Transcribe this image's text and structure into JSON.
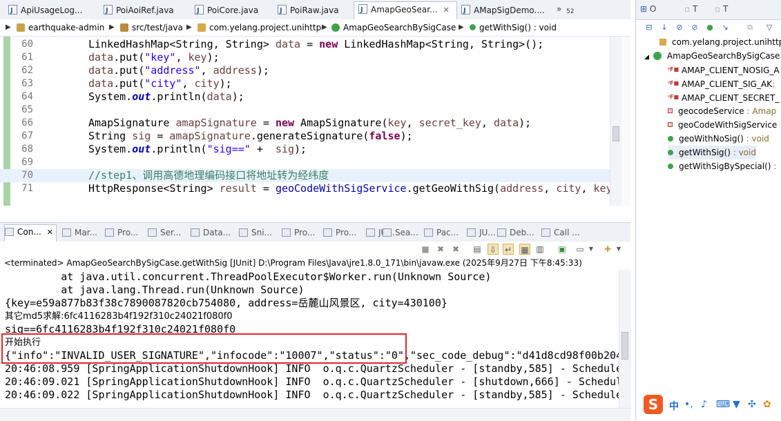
{
  "editor_tabs": [
    {
      "label": "ApiUsageLog...",
      "active": false
    },
    {
      "label": "PoiAoiRef.java",
      "active": false
    },
    {
      "label": "PoiCore.java",
      "active": false
    },
    {
      "label": "PoiRaw.java",
      "active": false
    },
    {
      "label": "AmapGeoSear...",
      "active": true,
      "close": "✕"
    },
    {
      "label": "AMapSigDemo....",
      "active": false
    }
  ],
  "tabs_overflow": {
    "chevron": "»",
    "count": "52"
  },
  "breadcrumb": [
    {
      "label": "earthquake-admin",
      "icon": "project-icon"
    },
    {
      "label": "src/test/java",
      "icon": "source-folder-icon"
    },
    {
      "label": "com.yelang.project.unihttp",
      "icon": "package-icon"
    },
    {
      "label": "AmapGeoSearchBySigCase",
      "icon": "class-icon"
    },
    {
      "label": "getWithSig() : void",
      "icon": "method-icon"
    }
  ],
  "code": {
    "line_numbers": [
      "60",
      "61",
      "62",
      "63",
      "64",
      "65",
      "66",
      "67",
      "68",
      "69",
      "70",
      "71"
    ],
    "lines": [
      [
        {
          "t": "LinkedHashMap<String, String> ",
          "c": ""
        },
        {
          "t": "data",
          "c": "loc"
        },
        {
          "t": " = ",
          "c": ""
        },
        {
          "t": "new",
          "c": "kw"
        },
        {
          "t": " LinkedHashMap<String, String>();",
          "c": ""
        }
      ],
      [
        {
          "t": "data",
          "c": "loc"
        },
        {
          "t": ".put(",
          "c": ""
        },
        {
          "t": "\"key\"",
          "c": "str"
        },
        {
          "t": ", ",
          "c": ""
        },
        {
          "t": "key",
          "c": "loc"
        },
        {
          "t": ");",
          "c": ""
        }
      ],
      [
        {
          "t": "data",
          "c": "loc"
        },
        {
          "t": ".put(",
          "c": ""
        },
        {
          "t": "\"address\"",
          "c": "str"
        },
        {
          "t": ", ",
          "c": ""
        },
        {
          "t": "address",
          "c": "loc"
        },
        {
          "t": ");",
          "c": ""
        }
      ],
      [
        {
          "t": "data",
          "c": "loc"
        },
        {
          "t": ".put(",
          "c": ""
        },
        {
          "t": "\"city\"",
          "c": "str"
        },
        {
          "t": ", ",
          "c": ""
        },
        {
          "t": "city",
          "c": "loc"
        },
        {
          "t": ");",
          "c": ""
        }
      ],
      [
        {
          "t": "System.",
          "c": ""
        },
        {
          "t": "out",
          "c": "sfld"
        },
        {
          "t": ".println(",
          "c": ""
        },
        {
          "t": "data",
          "c": "loc"
        },
        {
          "t": ");",
          "c": ""
        }
      ],
      [],
      [
        {
          "t": "AmapSignature ",
          "c": ""
        },
        {
          "t": "amapSignature",
          "c": "loc"
        },
        {
          "t": " = ",
          "c": ""
        },
        {
          "t": "new",
          "c": "kw"
        },
        {
          "t": " AmapSignature(",
          "c": ""
        },
        {
          "t": "key",
          "c": "loc"
        },
        {
          "t": ", ",
          "c": ""
        },
        {
          "t": "secret_key",
          "c": "loc"
        },
        {
          "t": ", ",
          "c": ""
        },
        {
          "t": "data",
          "c": "loc"
        },
        {
          "t": ");",
          "c": ""
        }
      ],
      [
        {
          "t": "String ",
          "c": ""
        },
        {
          "t": "sig",
          "c": "loc"
        },
        {
          "t": " = ",
          "c": ""
        },
        {
          "t": "amapSignature",
          "c": "loc"
        },
        {
          "t": ".generateSignature(",
          "c": ""
        },
        {
          "t": "false",
          "c": "kw"
        },
        {
          "t": ");",
          "c": ""
        }
      ],
      [
        {
          "t": "System.",
          "c": ""
        },
        {
          "t": "out",
          "c": "sfld"
        },
        {
          "t": ".println(",
          "c": ""
        },
        {
          "t": "\"sig==\"",
          "c": "str"
        },
        {
          "t": " +  ",
          "c": ""
        },
        {
          "t": "sig",
          "c": "loc"
        },
        {
          "t": ");",
          "c": ""
        }
      ],
      [],
      [
        {
          "t": "//step1、调用高德地理编码接口将地址转为经纬度",
          "c": "cmt"
        }
      ],
      [
        {
          "t": "HttpResponse<String> ",
          "c": ""
        },
        {
          "t": "result",
          "c": "loc"
        },
        {
          "t": " = ",
          "c": ""
        },
        {
          "t": "geoCodeWithSigService",
          "c": "fld"
        },
        {
          "t": ".getGeoWithSig(",
          "c": ""
        },
        {
          "t": "address",
          "c": "loc"
        },
        {
          "t": ", ",
          "c": ""
        },
        {
          "t": "city",
          "c": "loc"
        },
        {
          "t": ", ",
          "c": ""
        },
        {
          "t": "key",
          "c": "loc"
        }
      ]
    ],
    "current_line_index": 10
  },
  "views_tabs": [
    {
      "label": "Con...",
      "active": true,
      "close": "✕"
    },
    {
      "label": "Mar..."
    },
    {
      "label": "Pro..."
    },
    {
      "label": "Ser..."
    },
    {
      "label": "Data..."
    },
    {
      "label": "Sni..."
    },
    {
      "label": "Pro..."
    },
    {
      "label": "Pro..."
    },
    {
      "label": "JU..."
    },
    {
      "label": "Sea..."
    },
    {
      "label": "Pac..."
    },
    {
      "label": "JU..."
    },
    {
      "label": "Deb..."
    },
    {
      "label": "Call ..."
    }
  ],
  "console": {
    "status": "<terminated> AmapGeoSearchBySigCase.getWithSig [JUnit] D:\\Program Files\\Java\\jre1.8.0_171\\bin\\javaw.exe (2025年9月27日 下午8:45:33)",
    "lines": [
      "\tat java.util.concurrent.ThreadPoolExecutor$Worker.run(Unknown Source)",
      "\tat java.lang.Thread.run(Unknown Source)",
      "{key=e59a877b83f38c7890087820cb754080, address=岳麓山风景区, city=430100}",
      "其它md5求解:6fc4116283b4f192f310c24021f080f0",
      "sig==6fc4116283b4f192f310c24021f080f0",
      "开始执行",
      "{\"info\":\"INVALID_USER_SIGNATURE\",\"infocode\":\"10007\",\"status\":\"0\",\"sec_code_debug\":\"d41d8cd98f00b204",
      "20:46:08.959 [SpringApplicationShutdownHook] INFO  o.q.c.QuartzScheduler - [standby,585] - Schedule",
      "20:46:09.021 [SpringApplicationShutdownHook] INFO  o.q.c.QuartzScheduler - [shutdown,666] - Schedul",
      "20:46:09.022 [SpringApplicationShutdownHook] INFO  o.q.c.QuartzScheduler - [standby,585] - Schedule"
    ]
  },
  "outline": {
    "tabs": [
      {
        "label": "O",
        "icon": "outline-icon"
      },
      {
        "label": "T",
        "icon": "type-hierarchy-icon"
      },
      {
        "label": "T",
        "icon": "task-icon"
      }
    ],
    "package": "com.yelang.project.unihttp",
    "class_name": "AmapGeoSearchBySigCase",
    "members": [
      {
        "name": "AMAP_CLIENT_NOSIG_A",
        "type": "",
        "kind": "static-final-field"
      },
      {
        "name": "AMAP_CLIENT_SIG_AK",
        "type": ":",
        "kind": "static-final-field"
      },
      {
        "name": "AMAP_CLIENT_SECRET_",
        "type": "",
        "kind": "static-final-field"
      },
      {
        "name": "geocodeService",
        "type": " : Amap",
        "kind": "private-field"
      },
      {
        "name": "geoCodeWithSigService",
        "type": "",
        "kind": "private-field"
      },
      {
        "name": "geoWithNoSig()",
        "type": " : void",
        "kind": "public-method"
      },
      {
        "name": "getWithSig()",
        "type": " : void",
        "kind": "public-method",
        "selected": true
      },
      {
        "name": "getWithSigBySpecial()",
        "type": " :",
        "kind": "public-method"
      }
    ]
  },
  "ime": {
    "logo": "S",
    "lang": "中",
    "punct": "•,"
  }
}
